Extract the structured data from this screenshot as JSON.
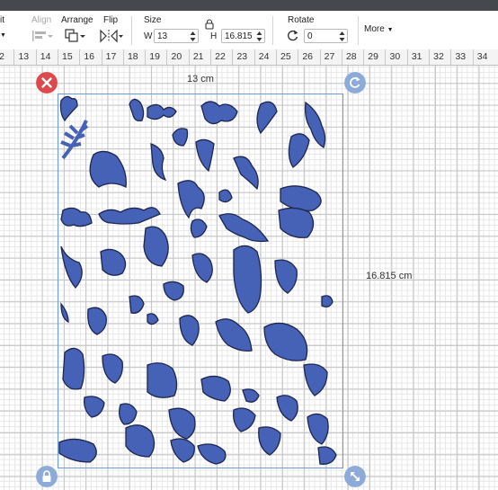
{
  "toolbar": {
    "edit_label": "it",
    "align_label": "Align",
    "arrange_label": "Arrange",
    "flip_label": "Flip",
    "size_label": "Size",
    "width_prefix": "W",
    "width_value": "13",
    "height_prefix": "H",
    "height_value": "16.815",
    "rotate_label": "Rotate",
    "rotate_value": "0",
    "more_label": "More"
  },
  "ruler": {
    "ticks": [
      "2",
      "13",
      "14",
      "15",
      "16",
      "17",
      "18",
      "19",
      "20",
      "21",
      "22",
      "23",
      "24",
      "25",
      "26",
      "27",
      "28",
      "29",
      "30",
      "31",
      "32",
      "33",
      "34"
    ]
  },
  "canvas": {
    "width_dimension": "13 cm",
    "height_dimension": "16.815 cm"
  },
  "colors": {
    "shape_fill": "#4662b6",
    "selection_border": "#6f9bd1",
    "delete_handle": "#dd4a4e",
    "control_handle": "#8cabd8"
  }
}
